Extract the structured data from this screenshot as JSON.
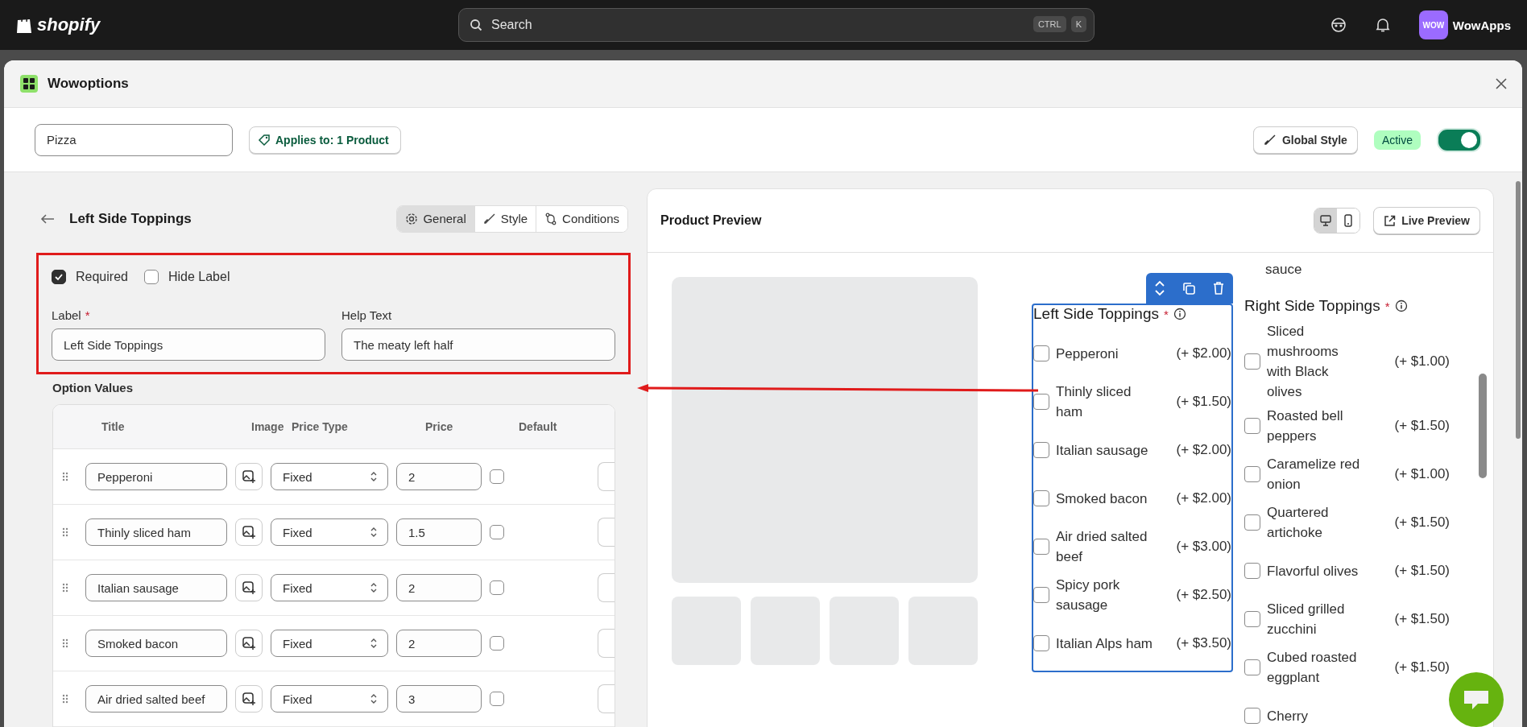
{
  "topbar": {
    "brand": "shopify",
    "search": {
      "placeholder": "Search",
      "shortcut": [
        "CTRL",
        "K"
      ]
    },
    "store": {
      "initials": "WOW",
      "name": "WowApps"
    }
  },
  "modal": {
    "title": "Wowoptions"
  },
  "toolbar": {
    "name_field": {
      "value": "Pizza"
    },
    "applies_to": "Applies to: 1 Product",
    "global_style": "Global Style",
    "status_badge": "Active",
    "active_toggle": {
      "on": true
    }
  },
  "editor": {
    "title": "Left Side Toppings",
    "tabs": [
      {
        "kind": "gear",
        "label": "General",
        "selected": true
      },
      {
        "kind": "brush",
        "label": "Style",
        "selected": false
      },
      {
        "kind": "branch",
        "label": "Conditions",
        "selected": false
      }
    ],
    "checks": [
      {
        "label": "Required",
        "checked": true
      },
      {
        "label": "Hide Label",
        "checked": false
      }
    ],
    "label_field": {
      "label": "Label",
      "required_mark": "*",
      "value": "Left Side Toppings"
    },
    "help_text": {
      "label": "Help Text",
      "value": "The meaty left half"
    },
    "option_values": {
      "heading": "Option Values",
      "columns": [
        "Title",
        "Image",
        "Price Type",
        "Price",
        "Default"
      ],
      "rows": [
        {
          "title": "Pepperoni",
          "price_type": "Fixed",
          "price": "2",
          "default": false
        },
        {
          "title": "Thinly sliced ham",
          "price_type": "Fixed",
          "price": "1.5",
          "default": false
        },
        {
          "title": "Italian sausage",
          "price_type": "Fixed",
          "price": "2",
          "default": false
        },
        {
          "title": "Smoked bacon",
          "price_type": "Fixed",
          "price": "2",
          "default": false
        },
        {
          "title": "Air dried salted beef",
          "price_type": "Fixed",
          "price": "3",
          "default": false
        }
      ]
    }
  },
  "preview": {
    "title": "Product Preview",
    "view_modes": [
      {
        "kind": "desktop",
        "selected": true
      },
      {
        "kind": "mobile",
        "selected": false
      }
    ],
    "live_preview": "Live Preview",
    "groups": [
      {
        "title": "Left Side Toppings",
        "required_mark": "*",
        "selected": true,
        "options": [
          {
            "name": "Pepperoni",
            "price": "(+ $2.00)",
            "checked": false
          },
          {
            "name": "Thinly sliced ham",
            "price": "(+ $1.50)",
            "checked": false
          },
          {
            "name": "Italian sausage",
            "price": "(+ $2.00)",
            "checked": false
          },
          {
            "name": "Smoked bacon",
            "price": "(+ $2.00)",
            "checked": false
          },
          {
            "name": "Air dried salted beef",
            "price": "(+ $3.00)",
            "checked": false
          },
          {
            "name": "Spicy pork sausage",
            "price": "(+ $2.50)",
            "checked": false
          },
          {
            "name": "Italian Alps ham",
            "price": "(+ $3.50)",
            "checked": false
          }
        ]
      },
      {
        "title": "Right Side Toppings",
        "required_mark": "*",
        "selected": false,
        "scrolled_text": "sauce",
        "options": [
          {
            "name": "Sliced mushrooms with Black olives",
            "price": "(+ $1.00)",
            "checked": false
          },
          {
            "name": "Roasted bell peppers",
            "price": "(+ $1.50)",
            "checked": false
          },
          {
            "name": "Caramelize red onion",
            "price": "(+ $1.00)",
            "checked": false
          },
          {
            "name": "Quartered artichoke",
            "price": "(+ $1.50)",
            "checked": false
          },
          {
            "name": "Flavorful olives",
            "price": "(+ $1.50)",
            "checked": false
          },
          {
            "name": "Sliced grilled zucchini",
            "price": "(+ $1.50)",
            "checked": false
          },
          {
            "name": "Cubed roasted eggplant",
            "price": "(+ $1.50)",
            "checked": false
          },
          {
            "name": "Cherry",
            "checked": false
          }
        ]
      }
    ]
  }
}
